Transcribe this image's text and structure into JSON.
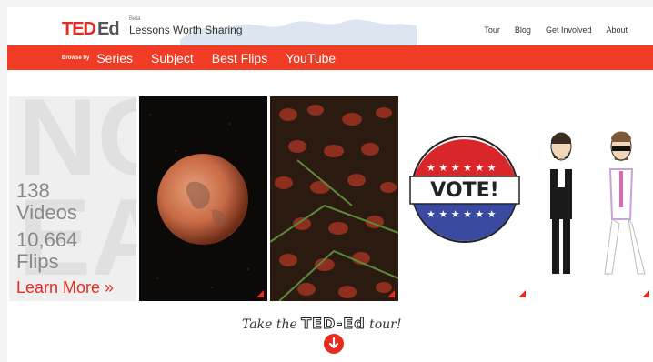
{
  "brand": {
    "ted": "TED",
    "ed": "Ed",
    "beta": "Beta",
    "tagline": "Lessons Worth Sharing"
  },
  "topnav": [
    "Tour",
    "Blog",
    "Get Involved",
    "About"
  ],
  "browse": {
    "label": "Browse by",
    "links": [
      "Series",
      "Subject",
      "Best Flips",
      "YouTube"
    ]
  },
  "stats": {
    "videos_count": "138",
    "videos_label": "Videos",
    "flips_count": "10,664",
    "flips_label": "Flips",
    "learn_more": "Learn More »"
  },
  "vote_badge": "VOTE!",
  "tour": {
    "prefix": "Take the",
    "brand": "TED-Ed",
    "suffix": "tour!"
  },
  "colors": {
    "accent": "#e62b1e",
    "nav_bar": "#f03c24"
  },
  "icons": {
    "tour_button": "arrow-down-icon",
    "tile_corner": "corner-triangle-icon"
  }
}
